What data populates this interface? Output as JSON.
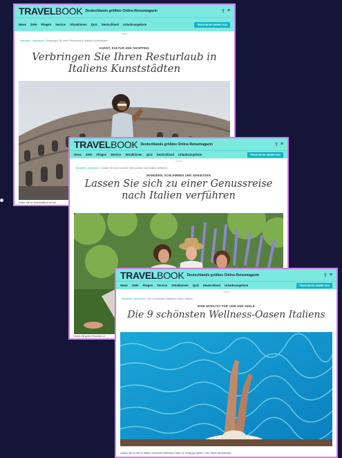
{
  "cards": [
    {
      "logo_bold": "TRAVEL",
      "logo_thin": "BOOK",
      "tagline": "Deutschlands größtes Online-Reisemagazin",
      "nav": [],
      "breadcrumb_link": "Startseite / Abenteuer",
      "breadcrumb_rest": " / Verbringen Sie Ihren Resturlaub in Italiens Kunststädten",
      "kicker": "KUNST, KULTUR UND SHOPPING",
      "title": "Verbringen Sie Ihren Resturlaub in Italiens Kunststädten",
      "caption": "Füllen Sie Ihr Urlaubsalbum mit sei"
    },
    {
      "logo_bold": "TRAVEL",
      "logo_thin": "BOOK",
      "tagline": "Deutschlands größtes Online-Reisemagazin",
      "nav": [
        "News",
        "Ziele",
        "Fliegen",
        "Service",
        "Attraktionen",
        "Quiz",
        "Deutschland",
        "Urlaubsangebote"
      ],
      "award": "TRAVELBOOK AWARD 2022",
      "breadcrumb_link": "Startseite / Abenteuer",
      "breadcrumb_rest": " / Lassen Sie sich zu einer Genussreise nach Italien verführen",
      "kicker": "WANDERN, SCHLEMMEN UND GENIESSEN",
      "title": "Lassen Sie sich zu einer Genussreise nach Italien verführen",
      "caption": "Macht mit guten Freunden ur"
    },
    {
      "logo_bold": "TRAVEL",
      "logo_thin": "BOOK",
      "tagline": "Deutschlands größtes Online-Reisemagazin",
      "nav": [
        "News",
        "Ziele",
        "Fliegen",
        "Service",
        "Attraktionen",
        "Quiz",
        "Deutschland",
        "Urlaubsangebote"
      ],
      "award": "TRAVELBOOK AWARD 2022",
      "breadcrumb_link": "Startseite / Abenteuer",
      "breadcrumb_rest": " / Die 9 schönsten Wellness-Oasen Italiens",
      "kicker": "EINE WOHLTAT FÜR LEIB UND SEELE",
      "title": "Die 9 schönsten Wellness-Oasen Italiens",
      "caption": "Lassen Sie es sich in Italiens schönsten Wellness-Oasen so richtig gut gehen.  Foto: Ebaln /iamsalmann"
    }
  ],
  "colors": {
    "background": "#15153a",
    "header": "#7ae9df",
    "accent": "#12b2c6",
    "frame": "#cf7fe6"
  },
  "icons": [
    "share-icon",
    "menu-icon"
  ]
}
